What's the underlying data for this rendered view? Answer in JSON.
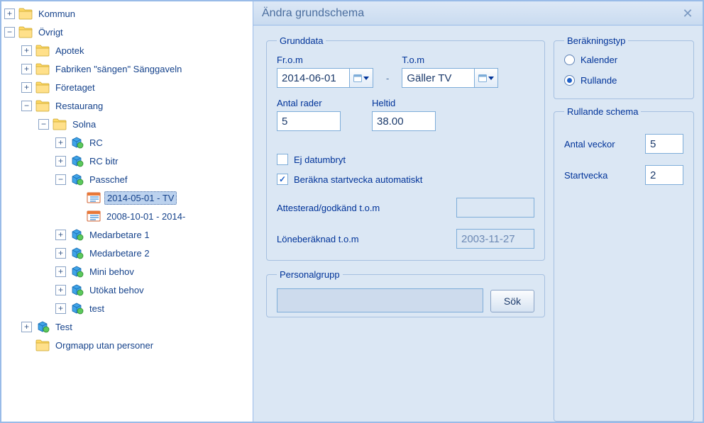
{
  "tree": {
    "kommun": "Kommun",
    "ovrigt": "Övrigt",
    "apotek": "Apotek",
    "fabriken": "Fabriken \"sängen\" Sänggaveln",
    "foretaget": "Företaget",
    "restaurang": "Restaurang",
    "solna": "Solna",
    "rc": "RC",
    "rc_bitr": "RC bitr",
    "passchef": "Passchef",
    "schedule1": "2014-05-01 - TV",
    "schedule2": "2008-10-01 - 2014-",
    "medarbetare1": "Medarbetare 1",
    "medarbetare2": "Medarbetare 2",
    "mini_behov": "Mini behov",
    "utokat_behov": "Utökat behov",
    "test_solna": "test",
    "test_top": "Test",
    "orgmapp": "Orgmapp utan personer"
  },
  "dialog": {
    "title": "Ändra grundschema",
    "grunddata_legend": "Grunddata",
    "from_label": "Fr.o.m",
    "from_value": "2014-06-01",
    "to_label": "T.o.m",
    "to_value": "Gäller TV",
    "antal_rader_label": "Antal rader",
    "antal_rader_value": "5",
    "heltid_label": "Heltid",
    "heltid_value": "38.00",
    "ej_datumbryt": "Ej datumbryt",
    "berakna_auto": "Beräkna startvecka automatiskt",
    "attesterad_label": "Attesterad/godkänd t.o.m",
    "attesterad_value": "",
    "loneberaknad_label": "Löneberäknad t.o.m",
    "loneberaknad_value": "2003-11-27",
    "berakningstyp_legend": "Beräkningstyp",
    "kalender": "Kalender",
    "rullande": "Rullande",
    "rullande_schema_legend": "Rullande schema",
    "antal_veckor_label": "Antal veckor",
    "antal_veckor_value": "5",
    "startvecka_label": "Startvecka",
    "startvecka_value": "2",
    "personalgrupp_legend": "Personalgrupp",
    "sok_btn": "Sök"
  }
}
